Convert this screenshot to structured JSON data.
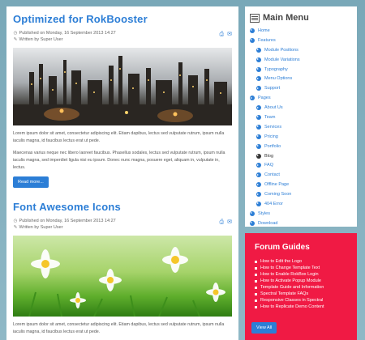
{
  "articles": [
    {
      "title": "Optimized for RokBooster",
      "published": "Published on Monday, 16 September 2013 14:27",
      "written": "Written by Super User",
      "para1": "Lorem ipsum dolor sit amet, consectetur adipiscing elit. Etiam dapibus, lectus sed vulputate rutrum, ipsum nulla iaculis magna, id faucibus lectus erat ut pede.",
      "para2": "Maecenas varius neque nec libero laoreet faucibus. Phasellus sodales, lectus sed vulputate rutrum, ipsum nulla iaculis magna, sed imperdiet ligula nisi eu ipsum. Donec nunc magna, posuere eget, aliquam in, vulputate in, lectus.",
      "read_more": "Read more..."
    },
    {
      "title": "Font Awesome Icons",
      "published": "Published on Monday, 16 September 2013 14:27",
      "written": "Written by Super User",
      "para1": "Lorem ipsum dolor sit amet, consectetur adipiscing elit. Etiam dapibus, lectus sed vulputate rutrum, ipsum nulla iaculis magna, id faucibus lectus erat ut pede."
    }
  ],
  "sidebar": {
    "title": "Main Menu",
    "items": [
      {
        "label": "Home",
        "level": 1
      },
      {
        "label": "Features",
        "level": 1
      },
      {
        "label": "Module Positions",
        "level": 2
      },
      {
        "label": "Module Variations",
        "level": 2
      },
      {
        "label": "Typography",
        "level": 2
      },
      {
        "label": "Menu Options",
        "level": 2
      },
      {
        "label": "Support",
        "level": 2
      },
      {
        "label": "Pages",
        "level": 1
      },
      {
        "label": "About Us",
        "level": 2
      },
      {
        "label": "Team",
        "level": 2
      },
      {
        "label": "Services",
        "level": 2
      },
      {
        "label": "Pricing",
        "level": 2
      },
      {
        "label": "Portfolio",
        "level": 2
      },
      {
        "label": "Blog",
        "level": 2,
        "active": true
      },
      {
        "label": "FAQ",
        "level": 2
      },
      {
        "label": "Contact",
        "level": 2
      },
      {
        "label": "Offline Page",
        "level": 2
      },
      {
        "label": "Coming Soon",
        "level": 2
      },
      {
        "label": "404 Error",
        "level": 2
      },
      {
        "label": "Styles",
        "level": 1
      },
      {
        "label": "Download",
        "level": 1
      }
    ]
  },
  "forum": {
    "title": "Forum Guides",
    "items": [
      "How to Edit the Logo",
      "How to Change Template Text",
      "How to Enable RokBox Login",
      "How to Activate Popup Module",
      "Template Guide and Information",
      "Spectral Template FAQs",
      "Responsive Classes in Spectral",
      "How to Replicate Demo Content"
    ],
    "view_all": "View All"
  },
  "colors": {
    "accent": "#2c7ed6",
    "forum_bg": "#f01a44",
    "background": "#8fb8c6"
  }
}
